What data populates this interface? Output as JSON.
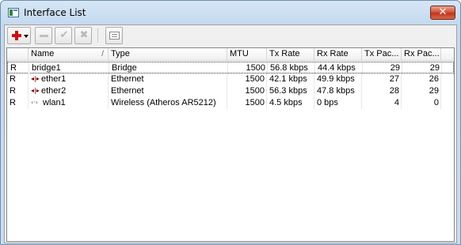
{
  "window": {
    "title": "Interface List",
    "close_label": "✕"
  },
  "toolbar": {
    "add_icon": "plus-icon",
    "remove_icon": "minus-icon",
    "enable_icon": "check-icon",
    "disable_icon": "x-icon",
    "comment_icon": "note-icon"
  },
  "columns": [
    "",
    "Name",
    "Type",
    "MTU",
    "Tx Rate",
    "Rx Rate",
    "Tx Pac...",
    "Rx Pac..."
  ],
  "sort_indicator": "/",
  "rows": [
    {
      "flag": "R",
      "icon": "",
      "name": "bridge1",
      "type": "Bridge",
      "mtu": "1500",
      "tx": "56.8 kbps",
      "rx": "44.4 kbps",
      "txp": "29",
      "rxp": "29"
    },
    {
      "flag": "R",
      "icon": "◂|▸",
      "name": "ether1",
      "type": "Ethernet",
      "mtu": "1500",
      "tx": "42.1 kbps",
      "rx": "49.9 kbps",
      "txp": "27",
      "rxp": "26"
    },
    {
      "flag": "R",
      "icon": "◂|▸",
      "name": "ether2",
      "type": "Ethernet",
      "mtu": "1500",
      "tx": "56.3 kbps",
      "rx": "47.8 kbps",
      "txp": "28",
      "rxp": "29"
    },
    {
      "flag": "R",
      "icon": "‹·›",
      "name": "wlan1",
      "type": "Wireless (Atheros AR5212)",
      "mtu": "1500",
      "tx": "4.5 kbps",
      "rx": "0 bps",
      "txp": "4",
      "rxp": "0"
    }
  ]
}
